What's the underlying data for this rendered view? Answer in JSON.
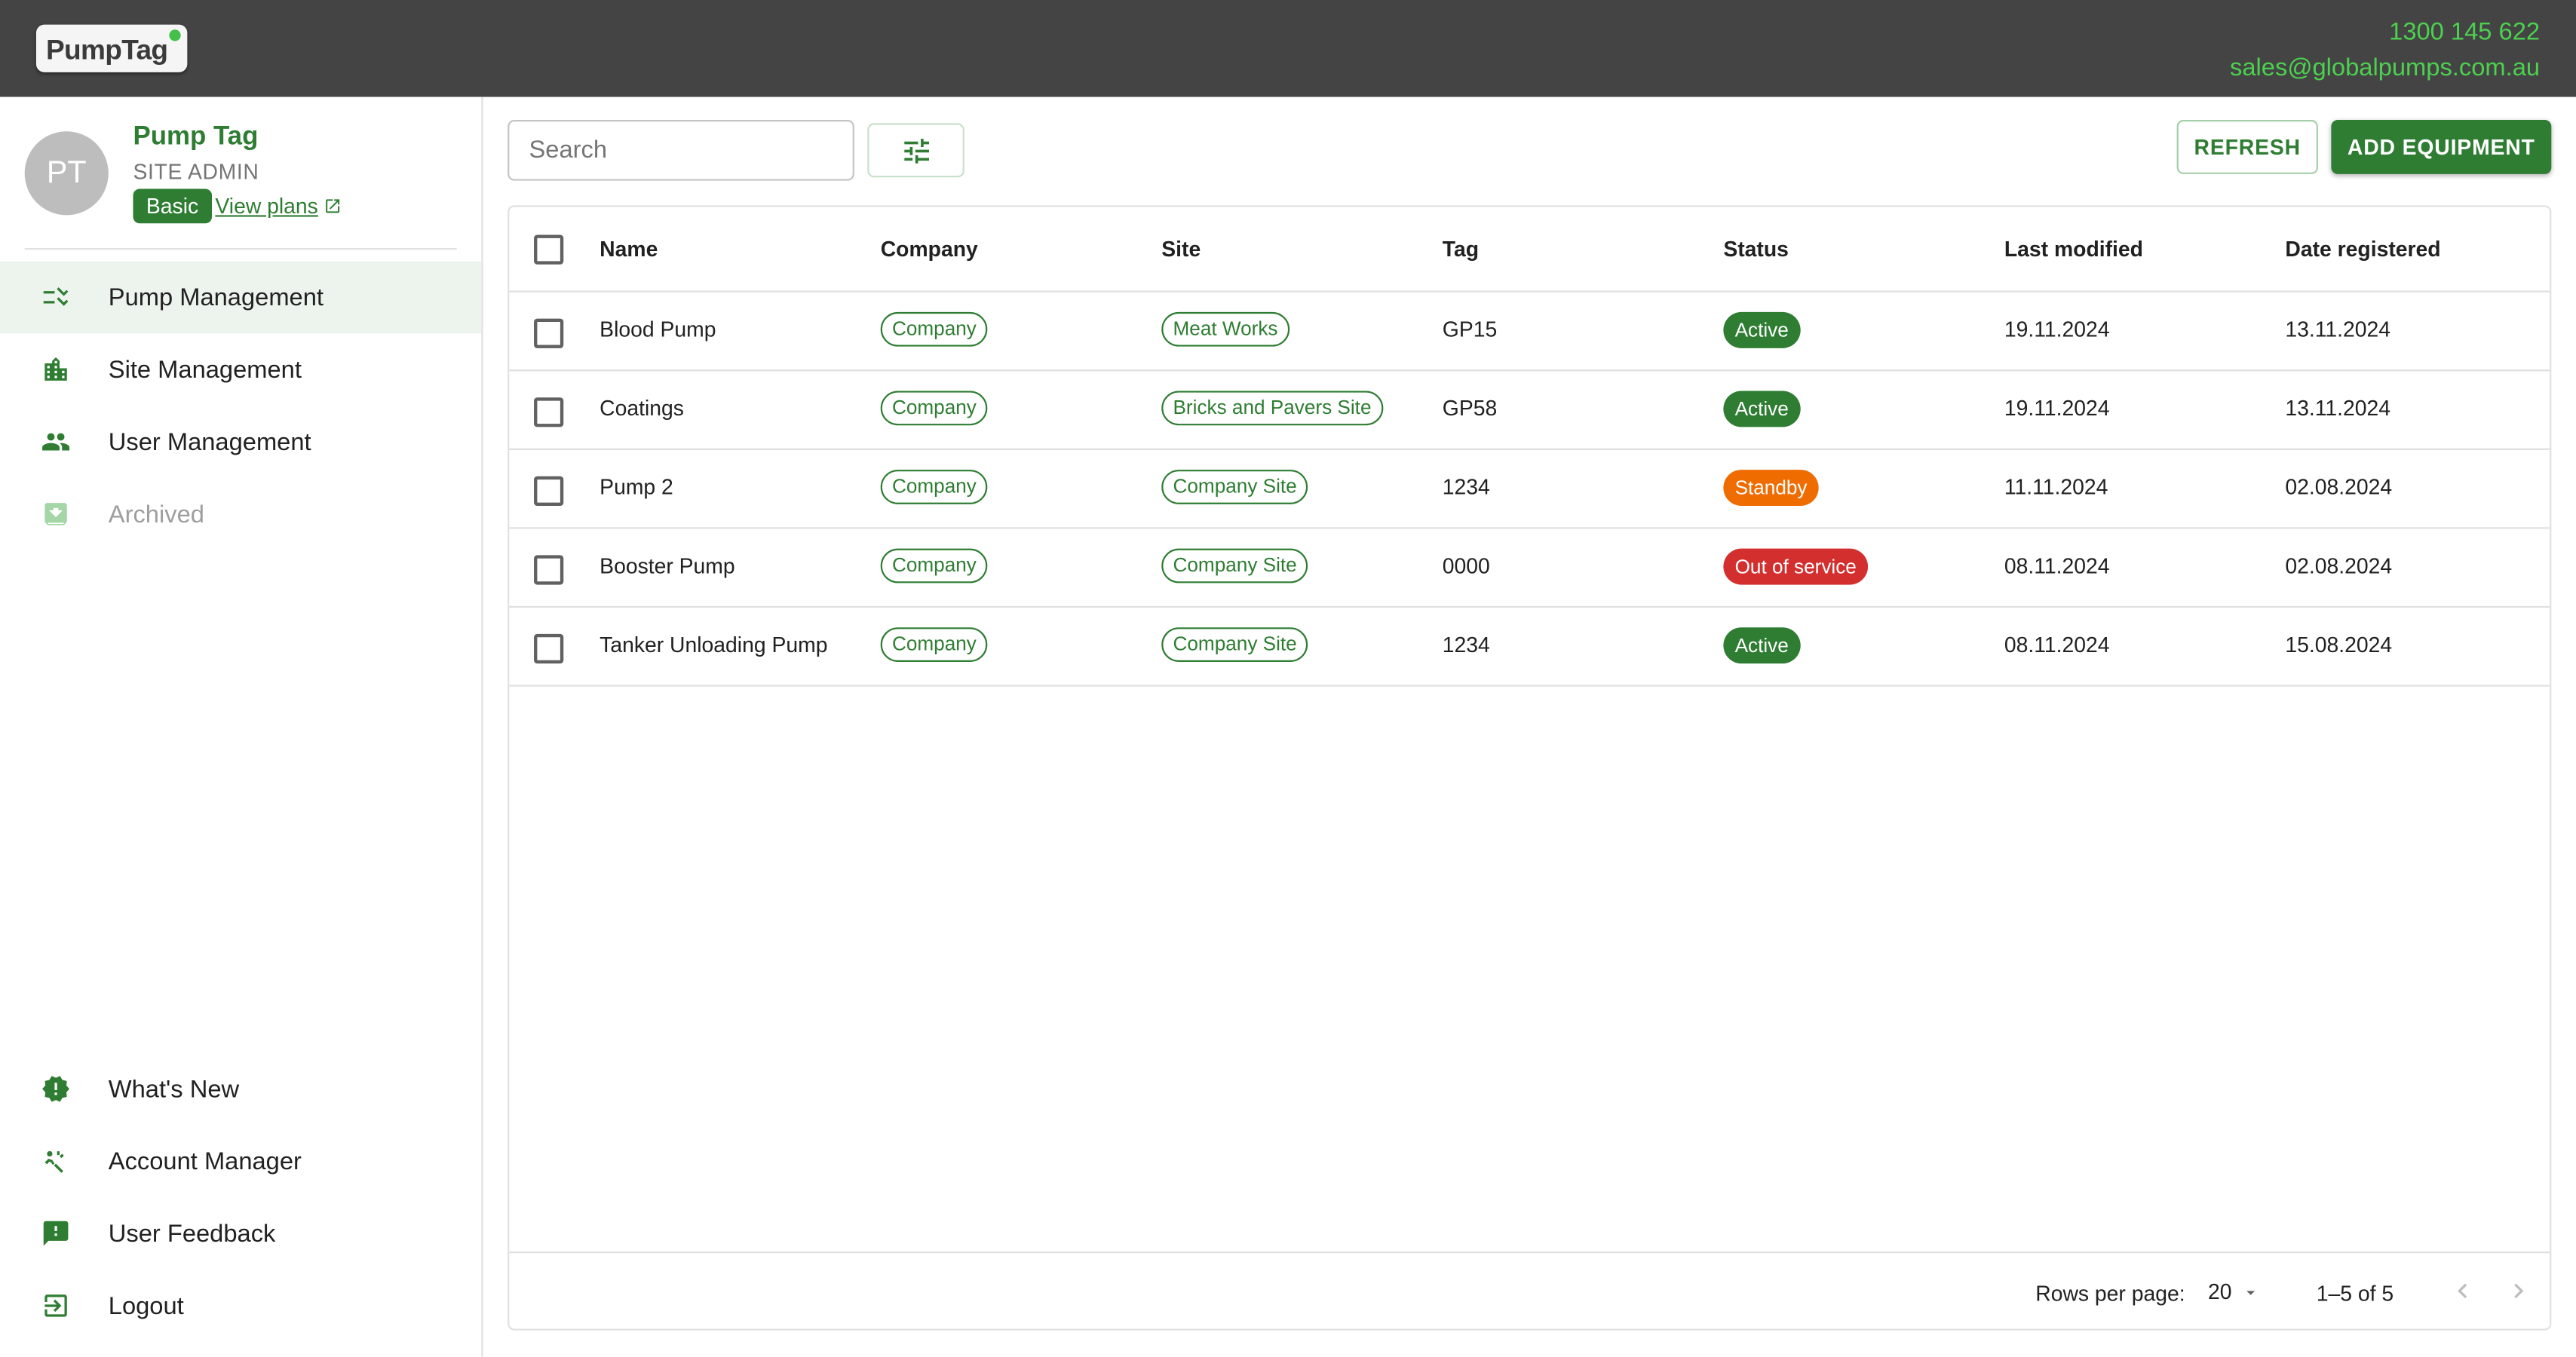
{
  "header": {
    "logo_text": "PumpTag",
    "phone": "1300 145 622",
    "email": "sales@globalpumps.com.au"
  },
  "profile": {
    "initials": "PT",
    "name": "Pump Tag",
    "role": "SITE ADMIN",
    "plan": "Basic",
    "view_plans": "View plans"
  },
  "sidebar": {
    "items": [
      {
        "label": "Pump Management",
        "icon": "checklist-icon"
      },
      {
        "label": "Site Management",
        "icon": "building-icon"
      },
      {
        "label": "User Management",
        "icon": "people-icon"
      },
      {
        "label": "Archived",
        "icon": "archive-icon"
      }
    ],
    "bottom_items": [
      {
        "label": "What's New",
        "icon": "new-releases-icon"
      },
      {
        "label": "Account Manager",
        "icon": "manager-icon"
      },
      {
        "label": "User Feedback",
        "icon": "feedback-icon"
      },
      {
        "label": "Logout",
        "icon": "logout-icon"
      }
    ]
  },
  "toolbar": {
    "search_placeholder": "Search",
    "refresh_label": "REFRESH",
    "add_label": "ADD EQUIPMENT"
  },
  "table": {
    "columns": [
      "Name",
      "Company",
      "Site",
      "Tag",
      "Status",
      "Last modified",
      "Date registered"
    ],
    "rows": [
      {
        "name": "Blood Pump",
        "company": "Company",
        "site": "Meat Works",
        "tag": "GP15",
        "status": "Active",
        "last_modified": "19.11.2024",
        "date_registered": "13.11.2024"
      },
      {
        "name": "Coatings",
        "company": "Company",
        "site": "Bricks and Pavers Site",
        "tag": "GP58",
        "status": "Active",
        "last_modified": "19.11.2024",
        "date_registered": "13.11.2024"
      },
      {
        "name": "Pump 2",
        "company": "Company",
        "site": "Company Site",
        "tag": "1234",
        "status": "Standby",
        "last_modified": "11.11.2024",
        "date_registered": "02.08.2024"
      },
      {
        "name": "Booster Pump",
        "company": "Company",
        "site": "Company Site",
        "tag": "0000",
        "status": "Out of service",
        "last_modified": "08.11.2024",
        "date_registered": "02.08.2024"
      },
      {
        "name": "Tanker Unloading Pump",
        "company": "Company",
        "site": "Company Site",
        "tag": "1234",
        "status": "Active",
        "last_modified": "08.11.2024",
        "date_registered": "15.08.2024"
      }
    ]
  },
  "status_colors": {
    "Active": "#2e7d32",
    "Standby": "#ef6c00",
    "Out of service": "#d32f2f"
  },
  "pagination": {
    "rows_per_page_label": "Rows per page:",
    "rows_per_page": "20",
    "range": "1–5 of 5"
  },
  "colors": {
    "brand_green": "#2e7d32",
    "topbar": "#444444",
    "contact_green": "#4cd14f"
  }
}
